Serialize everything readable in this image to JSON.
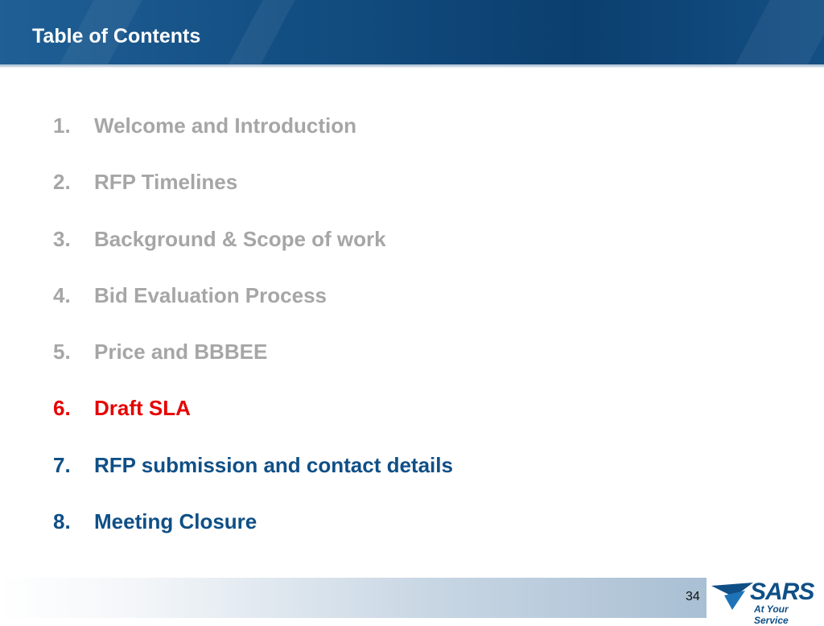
{
  "header": {
    "title": "Table of Contents"
  },
  "colors": {
    "header_blue": "#134e82",
    "done": "#a6a6a6",
    "current": "#e60000",
    "upcoming": "#0f4f86"
  },
  "toc": [
    {
      "number": "1.",
      "label": "Welcome and Introduction",
      "state": "done"
    },
    {
      "number": "2.",
      "label": "RFP Timelines",
      "state": "done"
    },
    {
      "number": "3.",
      "label": "Background & Scope of work",
      "state": "done"
    },
    {
      "number": "4.",
      "label": "Bid Evaluation Process",
      "state": "done"
    },
    {
      "number": "5.",
      "label": "Price and BBBEE",
      "state": "done"
    },
    {
      "number": "6.",
      "label": "Draft SLA",
      "state": "current"
    },
    {
      "number": "7.",
      "label": "RFP submission and contact details",
      "state": "upcoming"
    },
    {
      "number": "8.",
      "label": "Meeting Closure",
      "state": "upcoming"
    }
  ],
  "footer": {
    "page_number": "34",
    "logo_text": "SARS",
    "logo_tagline": "At Your Service"
  }
}
